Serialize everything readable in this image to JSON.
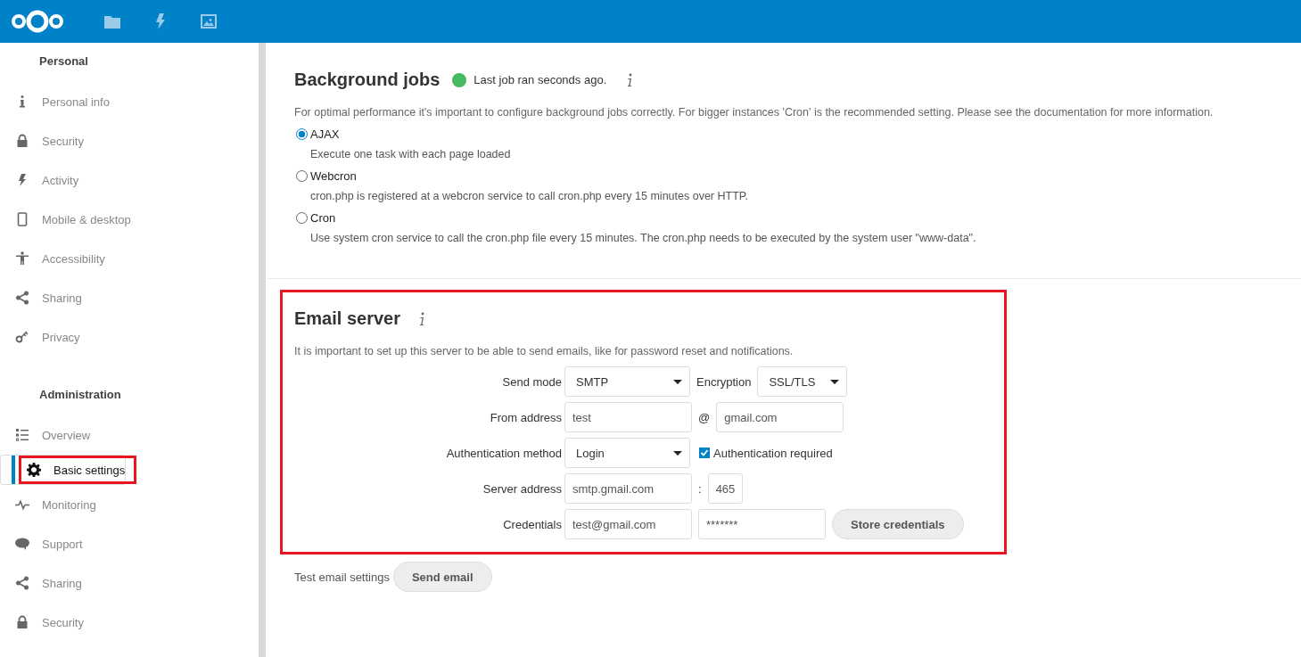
{
  "header": {
    "apps": [
      {
        "selected": false
      },
      {
        "selected": false
      },
      {
        "selected": false
      }
    ]
  },
  "sidebar": {
    "sections": [
      {
        "title": "Personal",
        "items": [
          {
            "label": "Personal info",
            "selected": false,
            "highlighted": false
          },
          {
            "label": "Security",
            "selected": false,
            "highlighted": false
          },
          {
            "label": "Activity",
            "selected": false,
            "highlighted": false
          },
          {
            "label": "Mobile & desktop",
            "selected": false,
            "highlighted": false
          },
          {
            "label": "Accessibility",
            "selected": false,
            "highlighted": false
          },
          {
            "label": "Sharing",
            "selected": false,
            "highlighted": false
          },
          {
            "label": "Privacy",
            "selected": false,
            "highlighted": false
          }
        ]
      },
      {
        "title": "Administration",
        "items": [
          {
            "label": "Overview",
            "selected": false,
            "highlighted": false
          },
          {
            "label": "Basic settings",
            "selected": true,
            "highlighted": true
          },
          {
            "label": "Monitoring",
            "selected": false,
            "highlighted": false
          },
          {
            "label": "Support",
            "selected": false,
            "highlighted": false
          },
          {
            "label": "Sharing",
            "selected": false,
            "highlighted": false
          },
          {
            "label": "Security",
            "selected": false,
            "highlighted": false
          }
        ]
      }
    ]
  },
  "background_jobs": {
    "title": "Background jobs",
    "status": "Last job ran seconds ago.",
    "description": "For optimal performance it's important to configure background jobs correctly. For bigger instances 'Cron' is the recommended setting. Please see the documentation for more information.",
    "options": [
      {
        "label": "AJAX",
        "hint": "Execute one task with each page loaded",
        "selected": true
      },
      {
        "label": "Webcron",
        "hint": "cron.php is registered at a webcron service to call cron.php every 15 minutes over HTTP.",
        "selected": false
      },
      {
        "label": "Cron",
        "hint": "Use system cron service to call the cron.php file every 15 minutes. The cron.php needs to be executed by the system user \"www-data\".",
        "selected": false
      }
    ]
  },
  "email_server": {
    "title": "Email server",
    "highlighted": true,
    "description": "It is important to set up this server to be able to send emails, like for password reset and notifications.",
    "rows": [
      {
        "label": "Send mode",
        "controls": [
          {
            "kind": "select",
            "value": "SMTP"
          },
          {
            "kind": "label",
            "text": "Encryption"
          },
          {
            "kind": "select",
            "value": "SSL/TLS"
          }
        ]
      },
      {
        "label": "From address",
        "controls": [
          {
            "kind": "input",
            "value": "test"
          },
          {
            "kind": "label",
            "text": "@"
          },
          {
            "kind": "input",
            "value": "gmail.com"
          }
        ]
      },
      {
        "label": "Authentication method",
        "controls": [
          {
            "kind": "select",
            "value": "Login"
          },
          {
            "kind": "checkbox",
            "text": "Authentication required",
            "checked": true
          }
        ]
      },
      {
        "label": "Server address",
        "controls": [
          {
            "kind": "input",
            "value": "smtp.gmail.com"
          },
          {
            "kind": "label",
            "text": ":"
          },
          {
            "kind": "input",
            "value": "465"
          }
        ]
      },
      {
        "label": "Credentials",
        "controls": [
          {
            "kind": "input",
            "value": "test@gmail.com"
          },
          {
            "kind": "input",
            "value": "*******"
          },
          {
            "kind": "button",
            "text": "Store credentials"
          }
        ]
      }
    ],
    "test_label": "Test email settings",
    "test_button": "Send email"
  }
}
